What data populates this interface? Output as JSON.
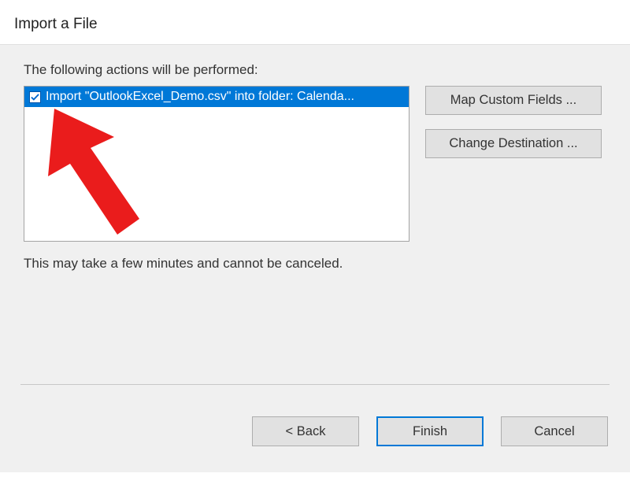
{
  "dialog": {
    "title": "Import a File"
  },
  "body": {
    "instruction": "The following actions will be performed:",
    "actions": [
      {
        "checked": true,
        "label": "Import \"OutlookExcel_Demo.csv\" into folder: Calenda..."
      }
    ],
    "note": "This may take a few minutes and cannot be canceled."
  },
  "sideButtons": {
    "mapFields": "Map Custom Fields ...",
    "changeDest": "Change Destination ..."
  },
  "footer": {
    "back": "<  Back",
    "finish": "Finish",
    "cancel": "Cancel"
  },
  "colors": {
    "selectionBg": "#0078d7",
    "annotationArrow": "#ea1c1c"
  }
}
